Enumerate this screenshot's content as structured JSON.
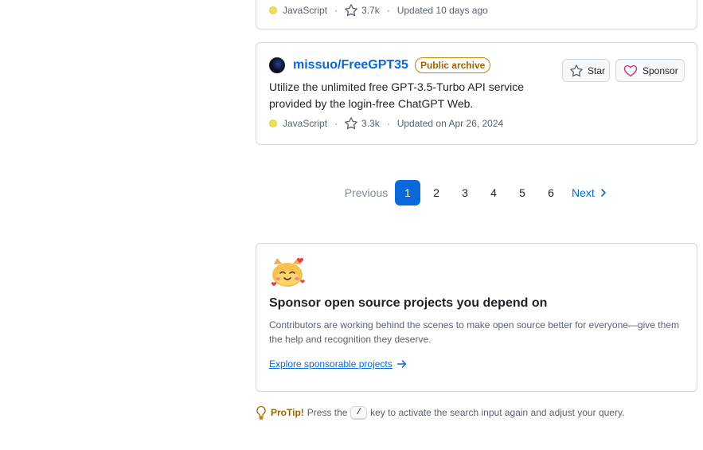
{
  "top_repo": {
    "language": "JavaScript",
    "stars": "3.7k",
    "updated": "Updated 10 days ago",
    "language_color": "#f1e05a"
  },
  "repo": {
    "name": "missuo/FreeGPT35",
    "badge": "Public archive",
    "description_line1": "Utilize the unlimited free GPT-3.5-Turbo API service",
    "description_line2": "provided by the login-free ChatGPT Web.",
    "language": "JavaScript",
    "stars": "3.3k",
    "updated": "Updated on Apr 26, 2024",
    "star_label": "Star",
    "sponsor_label": "Sponsor",
    "language_color": "#f1e05a"
  },
  "pagination": {
    "previous": "Previous",
    "pages": [
      "1",
      "2",
      "3",
      "4",
      "5",
      "6"
    ],
    "current": "1",
    "next": "Next"
  },
  "sponsor_card": {
    "title": "Sponsor open source projects you depend on",
    "text": "Contributors are working behind the scenes to make open source better for everyone—give them the help and recognition they deserve.",
    "link": "Explore sponsorable projects"
  },
  "protip": {
    "label": "ProTip!",
    "before": "Press the",
    "key": "/",
    "after": "key to activate the search input again and adjust your query."
  },
  "icons": {
    "star": "star-icon",
    "heart": "heart-icon",
    "chevron": "chevron-right-icon",
    "arrow": "arrow-right-icon",
    "bulb": "light-bulb-icon"
  },
  "colors": {
    "accent": "#0969da",
    "archive": "#9a6700",
    "sponsor_heart": "#bf3989"
  }
}
